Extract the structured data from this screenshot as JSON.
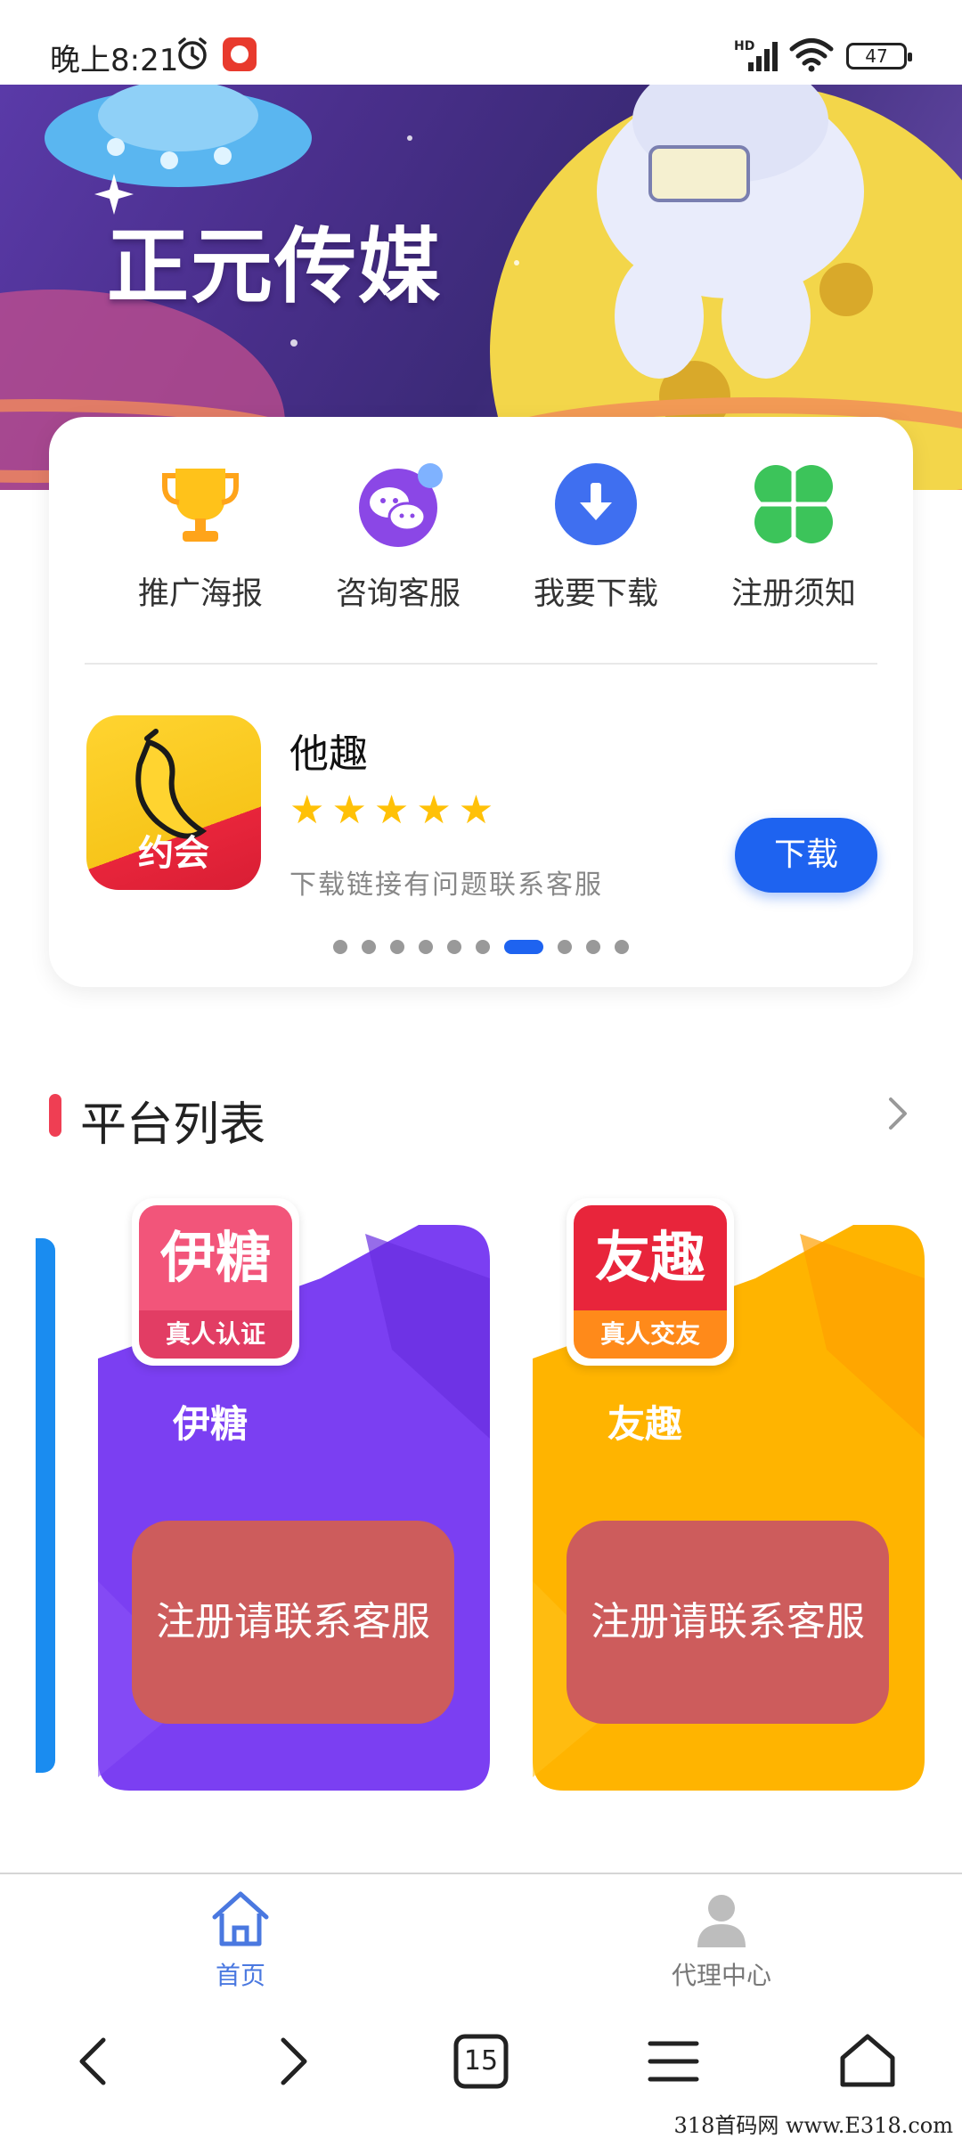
{
  "status_bar": {
    "time": "晚上8:21",
    "network_label": "HD",
    "battery": "47"
  },
  "banner": {
    "title": "正元传媒"
  },
  "quick_actions": [
    {
      "label": "推广海报",
      "icon": "trophy-icon"
    },
    {
      "label": "咨询客服",
      "icon": "chat-icon"
    },
    {
      "label": "我要下载",
      "icon": "download-icon"
    },
    {
      "label": "注册须知",
      "icon": "clover-icon"
    }
  ],
  "featured_app": {
    "name": "他趣",
    "logo_text": "约会",
    "rating": 5,
    "stars": "★★★★★",
    "note": "下载链接有问题联系客服",
    "download_label": "下载"
  },
  "carousel": {
    "total": 10,
    "active_index": 6
  },
  "platform_section": {
    "title": "平台列表"
  },
  "platforms": [
    {
      "name": "伊糖",
      "logo_top": "伊糖",
      "logo_bottom": "真人认证",
      "register_label": "注册请联系客服",
      "card_color": "#7b3ff2",
      "logo_color": "#f2557a"
    },
    {
      "name": "友趣",
      "logo_top": "友趣",
      "logo_bottom": "真人交友",
      "register_label": "注册请联系客服",
      "card_color": "#ffb400",
      "logo_color": "#e8253b"
    }
  ],
  "tab_bar": {
    "home_label": "首页",
    "agent_label": "代理中心",
    "active_color": "#4a78e0"
  },
  "browser_nav": {
    "tab_count": "15"
  },
  "watermark": "318首码网 www.E318.com"
}
